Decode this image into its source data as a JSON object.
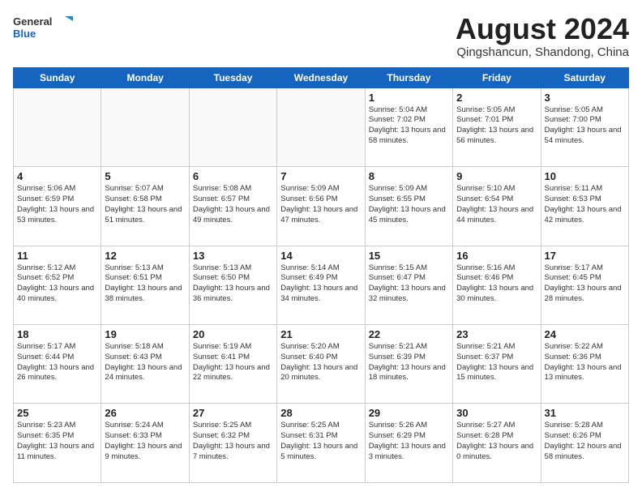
{
  "header": {
    "logo": {
      "text_general": "General",
      "text_blue": "Blue"
    },
    "month_title": "August 2024",
    "location": "Qingshancun, Shandong, China"
  },
  "days_of_week": [
    "Sunday",
    "Monday",
    "Tuesday",
    "Wednesday",
    "Thursday",
    "Friday",
    "Saturday"
  ],
  "weeks": [
    [
      {
        "day": "",
        "info": ""
      },
      {
        "day": "",
        "info": ""
      },
      {
        "day": "",
        "info": ""
      },
      {
        "day": "",
        "info": ""
      },
      {
        "day": "1",
        "info": "Sunrise: 5:04 AM\nSunset: 7:02 PM\nDaylight: 13 hours\nand 58 minutes."
      },
      {
        "day": "2",
        "info": "Sunrise: 5:05 AM\nSunset: 7:01 PM\nDaylight: 13 hours\nand 56 minutes."
      },
      {
        "day": "3",
        "info": "Sunrise: 5:05 AM\nSunset: 7:00 PM\nDaylight: 13 hours\nand 54 minutes."
      }
    ],
    [
      {
        "day": "4",
        "info": "Sunrise: 5:06 AM\nSunset: 6:59 PM\nDaylight: 13 hours\nand 53 minutes."
      },
      {
        "day": "5",
        "info": "Sunrise: 5:07 AM\nSunset: 6:58 PM\nDaylight: 13 hours\nand 51 minutes."
      },
      {
        "day": "6",
        "info": "Sunrise: 5:08 AM\nSunset: 6:57 PM\nDaylight: 13 hours\nand 49 minutes."
      },
      {
        "day": "7",
        "info": "Sunrise: 5:09 AM\nSunset: 6:56 PM\nDaylight: 13 hours\nand 47 minutes."
      },
      {
        "day": "8",
        "info": "Sunrise: 5:09 AM\nSunset: 6:55 PM\nDaylight: 13 hours\nand 45 minutes."
      },
      {
        "day": "9",
        "info": "Sunrise: 5:10 AM\nSunset: 6:54 PM\nDaylight: 13 hours\nand 44 minutes."
      },
      {
        "day": "10",
        "info": "Sunrise: 5:11 AM\nSunset: 6:53 PM\nDaylight: 13 hours\nand 42 minutes."
      }
    ],
    [
      {
        "day": "11",
        "info": "Sunrise: 5:12 AM\nSunset: 6:52 PM\nDaylight: 13 hours\nand 40 minutes."
      },
      {
        "day": "12",
        "info": "Sunrise: 5:13 AM\nSunset: 6:51 PM\nDaylight: 13 hours\nand 38 minutes."
      },
      {
        "day": "13",
        "info": "Sunrise: 5:13 AM\nSunset: 6:50 PM\nDaylight: 13 hours\nand 36 minutes."
      },
      {
        "day": "14",
        "info": "Sunrise: 5:14 AM\nSunset: 6:49 PM\nDaylight: 13 hours\nand 34 minutes."
      },
      {
        "day": "15",
        "info": "Sunrise: 5:15 AM\nSunset: 6:47 PM\nDaylight: 13 hours\nand 32 minutes."
      },
      {
        "day": "16",
        "info": "Sunrise: 5:16 AM\nSunset: 6:46 PM\nDaylight: 13 hours\nand 30 minutes."
      },
      {
        "day": "17",
        "info": "Sunrise: 5:17 AM\nSunset: 6:45 PM\nDaylight: 13 hours\nand 28 minutes."
      }
    ],
    [
      {
        "day": "18",
        "info": "Sunrise: 5:17 AM\nSunset: 6:44 PM\nDaylight: 13 hours\nand 26 minutes."
      },
      {
        "day": "19",
        "info": "Sunrise: 5:18 AM\nSunset: 6:43 PM\nDaylight: 13 hours\nand 24 minutes."
      },
      {
        "day": "20",
        "info": "Sunrise: 5:19 AM\nSunset: 6:41 PM\nDaylight: 13 hours\nand 22 minutes."
      },
      {
        "day": "21",
        "info": "Sunrise: 5:20 AM\nSunset: 6:40 PM\nDaylight: 13 hours\nand 20 minutes."
      },
      {
        "day": "22",
        "info": "Sunrise: 5:21 AM\nSunset: 6:39 PM\nDaylight: 13 hours\nand 18 minutes."
      },
      {
        "day": "23",
        "info": "Sunrise: 5:21 AM\nSunset: 6:37 PM\nDaylight: 13 hours\nand 15 minutes."
      },
      {
        "day": "24",
        "info": "Sunrise: 5:22 AM\nSunset: 6:36 PM\nDaylight: 13 hours\nand 13 minutes."
      }
    ],
    [
      {
        "day": "25",
        "info": "Sunrise: 5:23 AM\nSunset: 6:35 PM\nDaylight: 13 hours\nand 11 minutes."
      },
      {
        "day": "26",
        "info": "Sunrise: 5:24 AM\nSunset: 6:33 PM\nDaylight: 13 hours\nand 9 minutes."
      },
      {
        "day": "27",
        "info": "Sunrise: 5:25 AM\nSunset: 6:32 PM\nDaylight: 13 hours\nand 7 minutes."
      },
      {
        "day": "28",
        "info": "Sunrise: 5:25 AM\nSunset: 6:31 PM\nDaylight: 13 hours\nand 5 minutes."
      },
      {
        "day": "29",
        "info": "Sunrise: 5:26 AM\nSunset: 6:29 PM\nDaylight: 13 hours\nand 3 minutes."
      },
      {
        "day": "30",
        "info": "Sunrise: 5:27 AM\nSunset: 6:28 PM\nDaylight: 13 hours\nand 0 minutes."
      },
      {
        "day": "31",
        "info": "Sunrise: 5:28 AM\nSunset: 6:26 PM\nDaylight: 12 hours\nand 58 minutes."
      }
    ]
  ]
}
